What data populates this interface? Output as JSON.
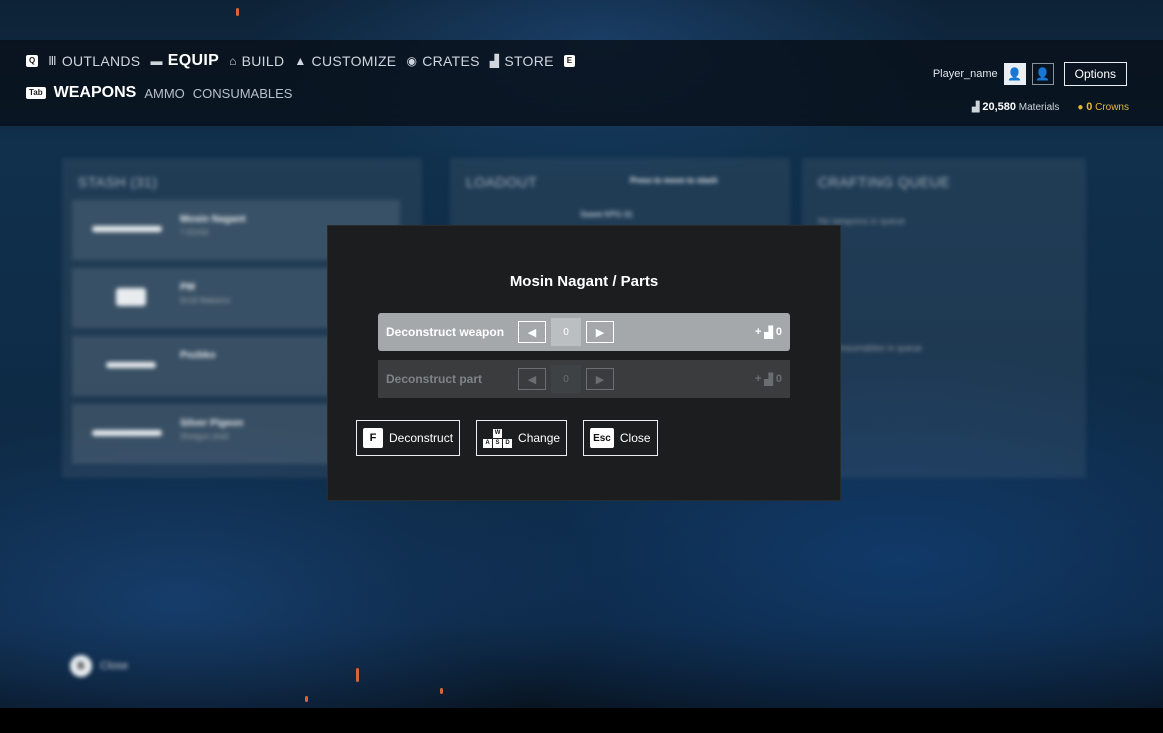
{
  "nav": {
    "items": [
      {
        "key": "Q",
        "icon": "ammo-icon",
        "label": "OUTLANDS",
        "active": false
      },
      {
        "icon": "chest-icon",
        "label": "EQUIP",
        "active": true
      },
      {
        "icon": "house-icon",
        "label": "BUILD",
        "active": false
      },
      {
        "icon": "jacket-icon",
        "label": "CUSTOMIZE",
        "active": false
      },
      {
        "icon": "crate-icon",
        "label": "CRATES",
        "active": false
      },
      {
        "icon": "store-icon",
        "label": "STORE",
        "key": "E",
        "active": false
      }
    ],
    "key_q": "Q",
    "key_e": "E"
  },
  "subnav": {
    "key": "Tab",
    "items": [
      "WEAPONS",
      "AMMO",
      "CONSUMABLES"
    ]
  },
  "player": {
    "name": "Player_name",
    "options_label": "Options",
    "materials_value": "20,580",
    "materials_label": "Materials",
    "crowns_value": "0",
    "crowns_label": "Crowns"
  },
  "background": {
    "stash_title": "STASH (31)",
    "stash_items": [
      {
        "name": "Mosin Nagant",
        "sub": "7.62x54"
      },
      {
        "name": "PM",
        "sub": "9x18 Makarov"
      },
      {
        "name": "Pozbko",
        "sub": ""
      },
      {
        "name": "Silver Pigeon",
        "sub": "Shotgun shell"
      }
    ],
    "loadout_title": "LOADOUT",
    "loadout_hint": "Press to move to stash",
    "loadout_slot": "Sweet KPG-31",
    "crafting_title": "CRAFTING QUEUE",
    "crafting_empty": "No weapons in queue",
    "crafting_empty2": "No consumables in queue"
  },
  "modal": {
    "title": "Mosin Nagant / Parts",
    "rows": [
      {
        "label": "Deconstruct weapon",
        "value": "0",
        "gain_prefix": "+",
        "gain_value": "0",
        "enabled": true
      },
      {
        "label": "Deconstruct part",
        "value": "0",
        "gain_prefix": "+",
        "gain_value": "0",
        "enabled": false
      }
    ],
    "actions": {
      "deconstruct_key": "F",
      "deconstruct_label": "Deconstruct",
      "change_keys": [
        "W",
        "A",
        "S",
        "D"
      ],
      "change_label": "Change",
      "close_key": "Esc",
      "close_label": "Close"
    }
  },
  "footer": {
    "close_key": "B",
    "close_label": "Close"
  },
  "colors": {
    "accent_gold": "#e3b93a",
    "modal_bg": "#1c1d1e",
    "row_active": "#a5a8ab"
  }
}
